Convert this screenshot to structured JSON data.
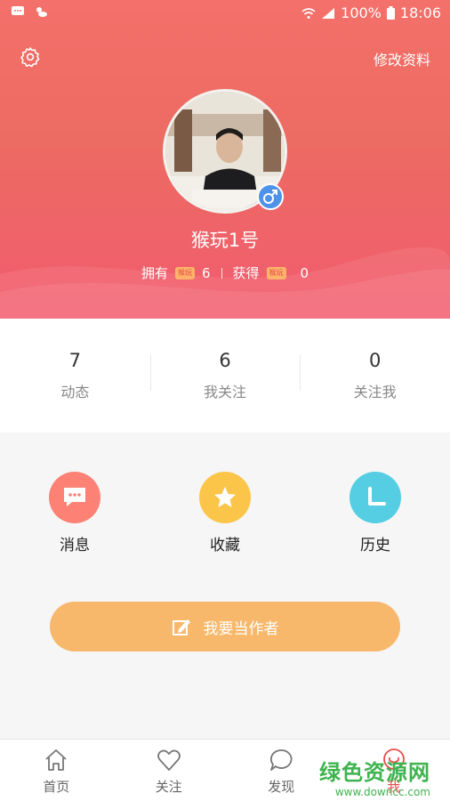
{
  "status_bar": {
    "battery": "100%",
    "time": "18:06"
  },
  "header": {
    "edit_profile": "修改资料"
  },
  "profile": {
    "username": "猴玩1号"
  },
  "stats": {
    "own_label": "拥有",
    "own_tag": "猴玩",
    "own_value": "6",
    "earn_label": "获得",
    "earn_tag": "猴玩",
    "earn_value": "0"
  },
  "counts": [
    {
      "num": "7",
      "label": "动态"
    },
    {
      "num": "6",
      "label": "我关注"
    },
    {
      "num": "0",
      "label": "关注我"
    }
  ],
  "actions": [
    {
      "label": "消息",
      "icon": "message-icon",
      "color": "#fd8275"
    },
    {
      "label": "收藏",
      "icon": "star-icon",
      "color": "#fbc54a"
    },
    {
      "label": "历史",
      "icon": "clock-icon",
      "color": "#55cde3"
    }
  ],
  "author_button": {
    "label": "我要当作者"
  },
  "bottom_nav": [
    {
      "label": "首页",
      "icon": "home-icon"
    },
    {
      "label": "关注",
      "icon": "heart-icon"
    },
    {
      "label": "发现",
      "icon": "chat-bubble-icon"
    },
    {
      "label": "我",
      "icon": "me-icon"
    }
  ],
  "watermark": {
    "text": "绿色资源网",
    "url_text": "www.downcc.com"
  },
  "colors": {
    "primary": "#f0665f",
    "accent": "#e94a4a",
    "author_button": "#f8b86c"
  }
}
